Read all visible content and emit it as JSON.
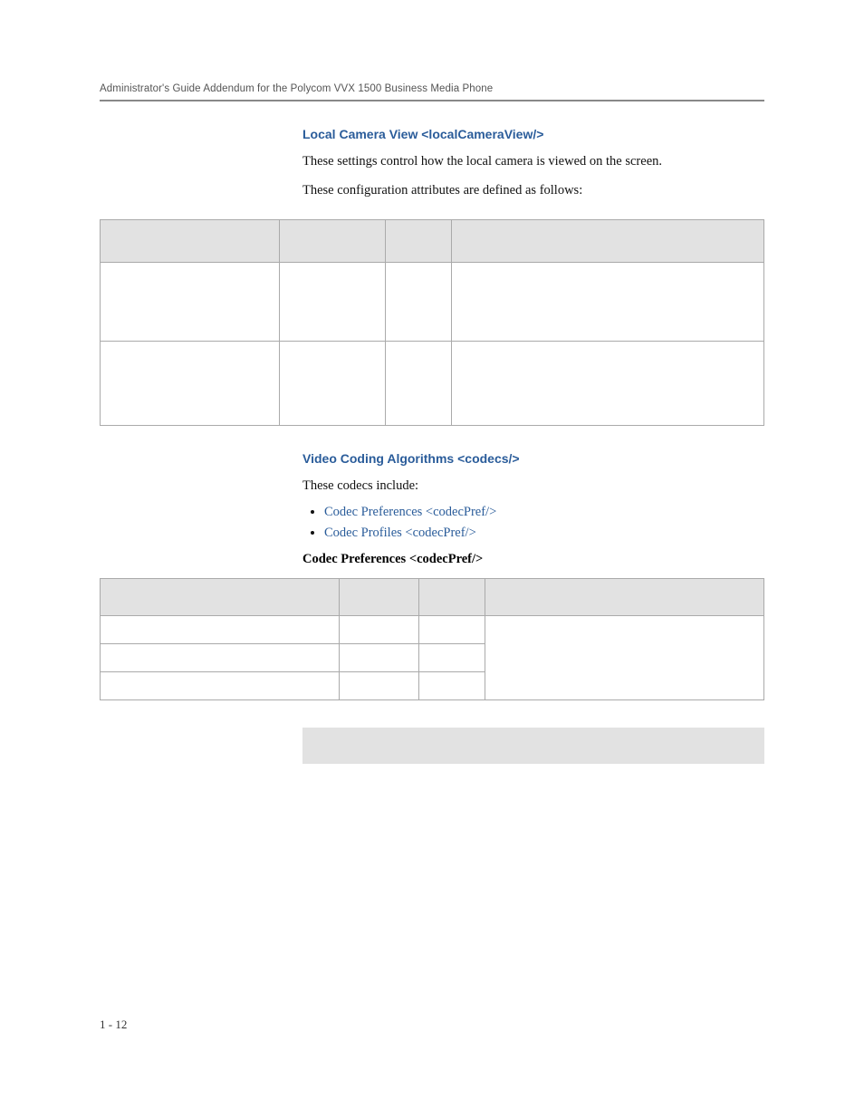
{
  "header": {
    "running": "Administrator's Guide Addendum for the Polycom VVX 1500 Business Media Phone"
  },
  "section1": {
    "heading": "Local Camera View <localCameraView/>",
    "p1": "These settings control how the local camera is viewed on the screen.",
    "p2": "These configuration attributes are defined as follows:"
  },
  "section2": {
    "heading": "Video Coding Algorithms <codecs/>",
    "intro": "These codecs include:",
    "bullets": {
      "0": "Codec Preferences <codecPref/>",
      "1": "Codec Profiles <codecPref/>"
    },
    "subheading": "Codec Preferences <codecPref/>"
  },
  "footer": {
    "pageNumber": "1 - 12"
  }
}
